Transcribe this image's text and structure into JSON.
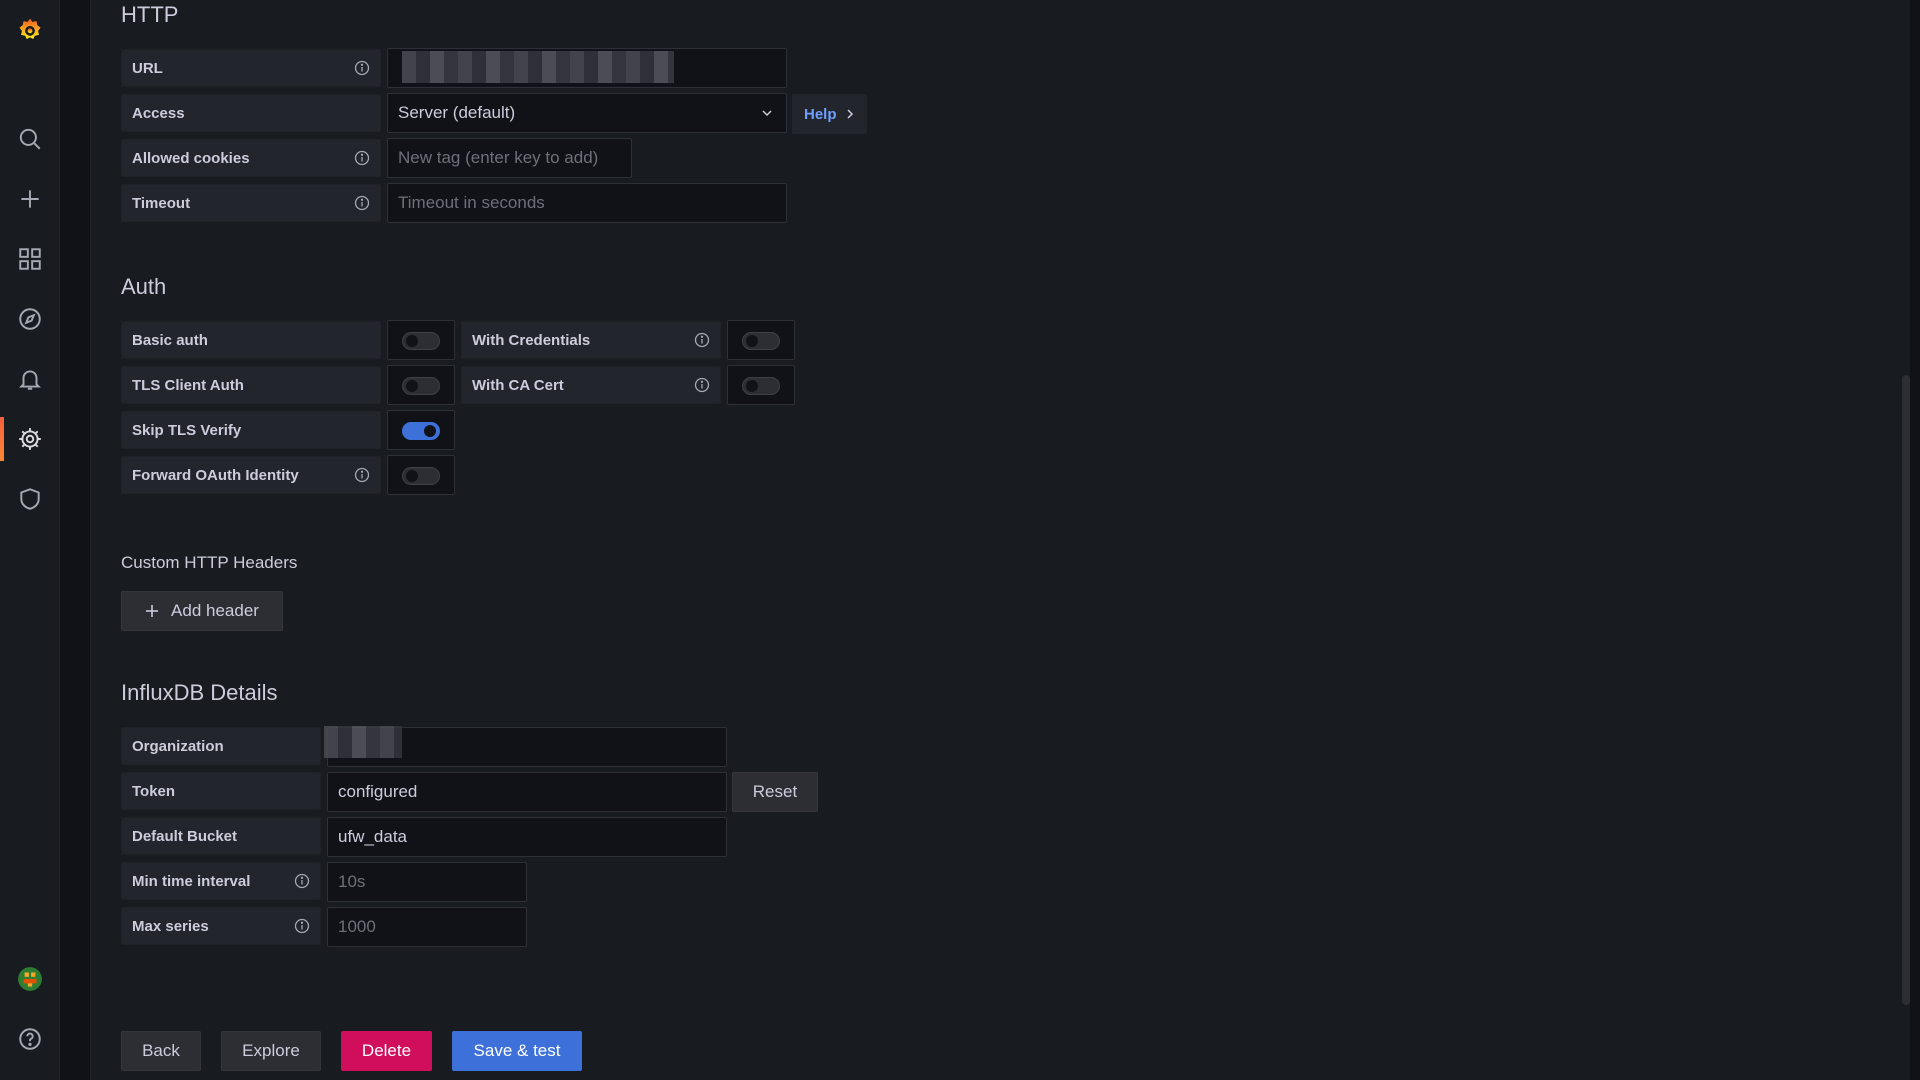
{
  "sidebar": {
    "items": [
      {
        "name": "grafana-logo",
        "icon": "grafana-logo-icon"
      },
      {
        "name": "search",
        "icon": "search-icon"
      },
      {
        "name": "create",
        "icon": "plus-icon"
      },
      {
        "name": "dashboards",
        "icon": "dashboards-grid-icon"
      },
      {
        "name": "explore",
        "icon": "compass-icon"
      },
      {
        "name": "alerting",
        "icon": "bell-icon"
      },
      {
        "name": "configuration",
        "icon": "gear-icon",
        "active": true
      },
      {
        "name": "server-admin",
        "icon": "shield-icon"
      },
      {
        "name": "profile",
        "icon": "avatar-icon"
      },
      {
        "name": "help",
        "icon": "question-circle-icon"
      }
    ],
    "accent": "#f55f3e"
  },
  "http": {
    "title": "HTTP",
    "url_label": "URL",
    "access_label": "Access",
    "access_value": "Server (default)",
    "help_label": "Help",
    "cookies_label": "Allowed cookies",
    "cookies_placeholder": "New tag (enter key to add)",
    "timeout_label": "Timeout",
    "timeout_placeholder": "Timeout in seconds"
  },
  "auth": {
    "title": "Auth",
    "basic_auth": {
      "label": "Basic auth",
      "on": false
    },
    "with_credentials": {
      "label": "With Credentials",
      "on": false
    },
    "tls_client_auth": {
      "label": "TLS Client Auth",
      "on": false
    },
    "with_ca_cert": {
      "label": "With CA Cert",
      "on": false
    },
    "skip_tls_verify": {
      "label": "Skip TLS Verify",
      "on": true
    },
    "forward_oauth": {
      "label": "Forward OAuth Identity",
      "on": false
    }
  },
  "custom_headers": {
    "title": "Custom HTTP Headers",
    "add_label": "Add header"
  },
  "influx": {
    "title": "InfluxDB Details",
    "org_label": "Organization",
    "token_label": "Token",
    "token_value": "configured",
    "reset_label": "Reset",
    "bucket_label": "Default Bucket",
    "bucket_value": "ufw_data",
    "min_interval_label": "Min time interval",
    "min_interval_placeholder": "10s",
    "max_series_label": "Max series",
    "max_series_placeholder": "1000"
  },
  "actions": {
    "back": "Back",
    "explore": "Explore",
    "delete": "Delete",
    "save": "Save & test"
  },
  "colors": {
    "primary": "#3d71d9",
    "danger": "#d10e5c",
    "link": "#6e9fff"
  }
}
